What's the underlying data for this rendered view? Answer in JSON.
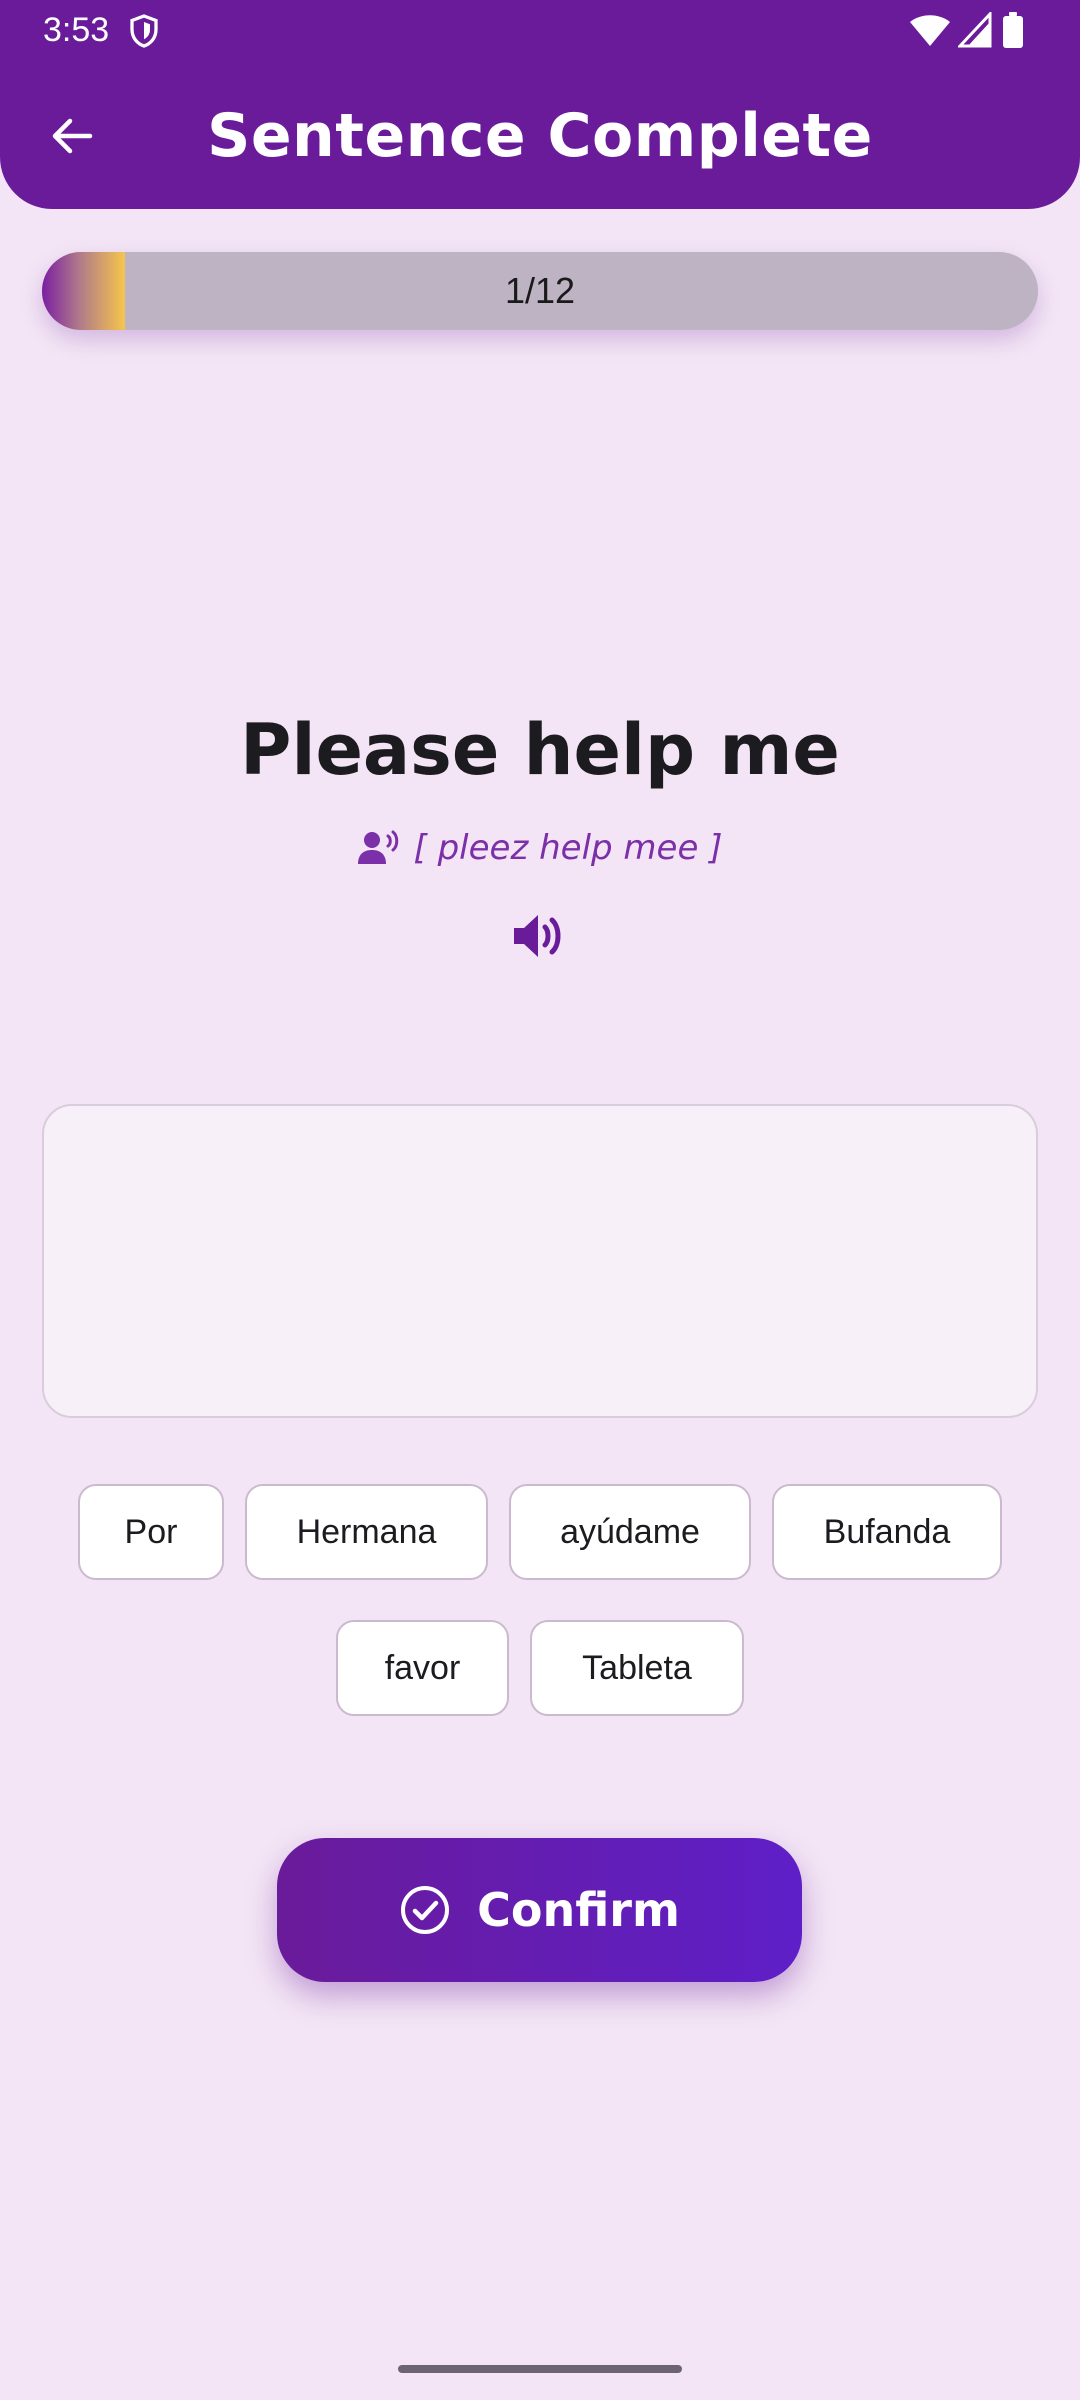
{
  "status_bar": {
    "time": "3:53",
    "icons": [
      "shield-icon",
      "wifi-icon",
      "signal-icon",
      "battery-icon"
    ]
  },
  "header": {
    "title": "Sentence Complete",
    "back_icon": "arrow-left-icon"
  },
  "progress": {
    "label": "1/12",
    "current": 1,
    "total": 12
  },
  "prompt": {
    "sentence": "Please help me",
    "pronunciation": "[ pleez help mee ]",
    "pronunciation_icon": "speaking-person-icon",
    "audio_icon": "speaker-icon"
  },
  "answer": {
    "selected_words": []
  },
  "word_bank": {
    "words": [
      "Por",
      "Hermana",
      "ayúdame",
      "Bufanda",
      "favor",
      "Tableta"
    ]
  },
  "confirm": {
    "label": "Confirm",
    "icon": "check-circle-icon"
  },
  "colors": {
    "background": "#F3E5F5",
    "header": "#6A1B9A",
    "accent": "#7B2FA8",
    "progress_track": "#BDB3C2",
    "progress_fill_end": "#F6C54C",
    "chip_border": "#CBB9CF"
  }
}
